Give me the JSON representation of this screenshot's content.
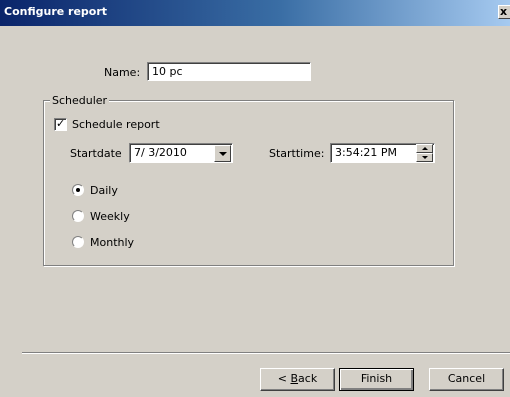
{
  "window": {
    "title": "Configure report",
    "close_glyph": "x"
  },
  "form": {
    "name_label": "Name:",
    "name_value": "10 pc"
  },
  "scheduler": {
    "group_label": "Scheduler",
    "schedule_report_label": "Schedule report",
    "schedule_report_checked": true,
    "startdate_label": "Startdate",
    "startdate_value": "7/ 3/2010",
    "starttime_label": "Starttime:",
    "starttime_value": "3:54:21 PM",
    "frequency_options": [
      "Daily",
      "Weekly",
      "Monthly"
    ],
    "frequency_selected": "Daily"
  },
  "buttons": {
    "back_prefix": "< ",
    "back_mnemonic": "B",
    "back_rest": "ack",
    "finish": "Finish",
    "cancel": "Cancel"
  },
  "icons": {
    "close": "close-icon",
    "checkmark": "checkmark-icon",
    "dropdown": "chevron-down-icon",
    "spin_up": "spin-up-icon",
    "spin_down": "spin-down-icon"
  }
}
